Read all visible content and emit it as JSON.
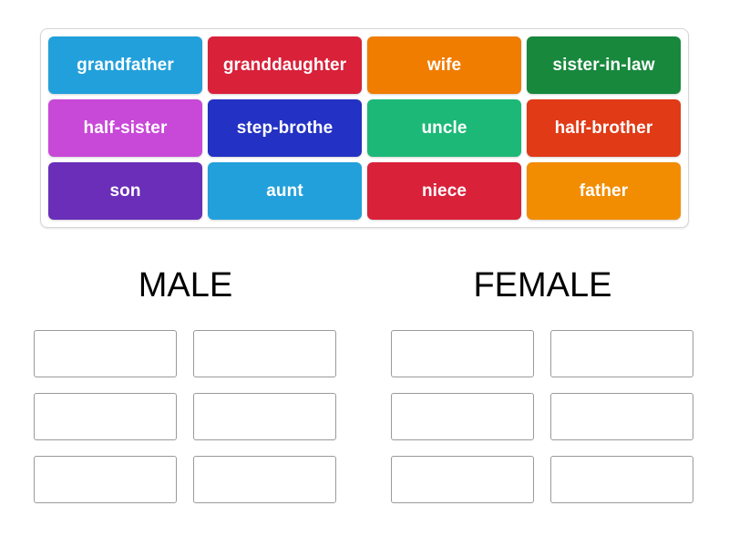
{
  "activity": {
    "type": "group-sort",
    "word_bank": {
      "tiles": [
        {
          "label": "grandfather",
          "color": "#22A0DB"
        },
        {
          "label": "granddaughter",
          "color": "#D9213A"
        },
        {
          "label": "wife",
          "color": "#F07C00"
        },
        {
          "label": "sister-in-law",
          "color": "#17883C"
        },
        {
          "label": "half-sister",
          "color": "#C848D8"
        },
        {
          "label": "step-brothe",
          "color": "#2331C4"
        },
        {
          "label": "uncle",
          "color": "#1CB878"
        },
        {
          "label": "half-brother",
          "color": "#E03A16"
        },
        {
          "label": "son",
          "color": "#6A2EB8"
        },
        {
          "label": "aunt",
          "color": "#22A0DB"
        },
        {
          "label": "niece",
          "color": "#D9213A"
        },
        {
          "label": "father",
          "color": "#F28C00"
        }
      ]
    },
    "categories": [
      {
        "id": "male",
        "heading": "MALE",
        "slot_count": 6
      },
      {
        "id": "female",
        "heading": "FEMALE",
        "slot_count": 6
      }
    ]
  },
  "colors": {
    "page_background": "#FFFFFF",
    "panel_border": "#D6D6D6",
    "dropzone_border": "#9A9A9A",
    "heading_text": "#000000",
    "tile_text": "#FFFFFF"
  }
}
